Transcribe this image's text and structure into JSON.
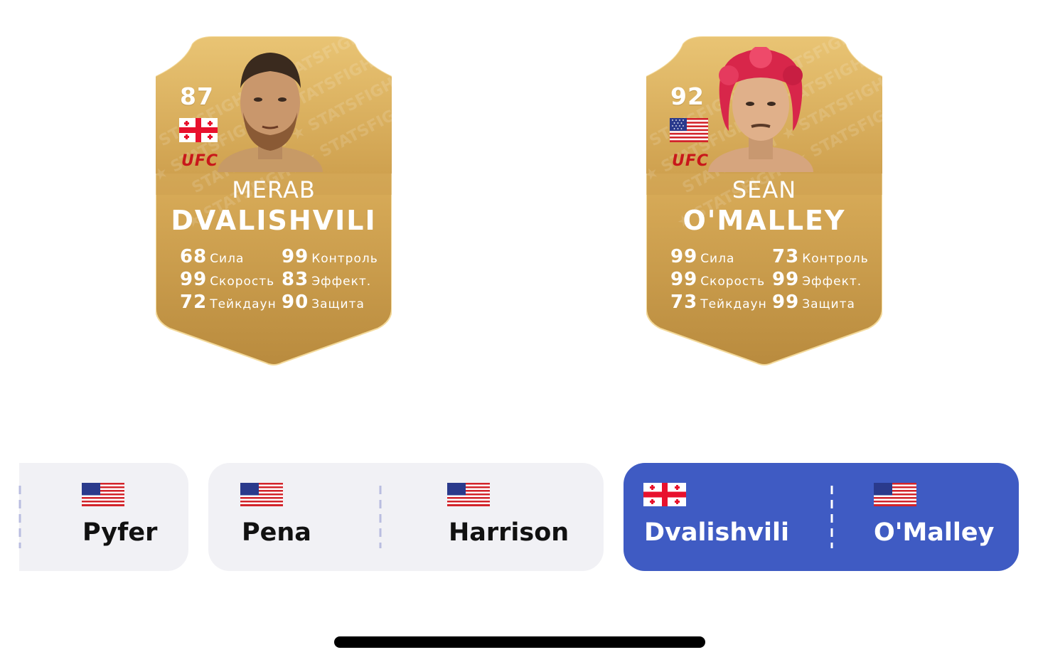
{
  "cards": [
    {
      "rating": "87",
      "first_name": "MERAB",
      "last_name": "DVALISHVILI",
      "league": "UFC",
      "country": "georgia",
      "hair_color": "#3a2a1e",
      "stats": [
        {
          "value": "68",
          "label": "Сила"
        },
        {
          "value": "99",
          "label": "Контроль"
        },
        {
          "value": "99",
          "label": "Скорость"
        },
        {
          "value": "83",
          "label": "Эффект."
        },
        {
          "value": "72",
          "label": "Тейкдаун"
        },
        {
          "value": "90",
          "label": "Защита"
        }
      ]
    },
    {
      "rating": "92",
      "first_name": "SEAN",
      "last_name": "O'MALLEY",
      "league": "UFC",
      "country": "usa",
      "hair_color": "#d8264a",
      "stats": [
        {
          "value": "99",
          "label": "Сила"
        },
        {
          "value": "73",
          "label": "Контроль"
        },
        {
          "value": "99",
          "label": "Скорость"
        },
        {
          "value": "99",
          "label": "Эффект."
        },
        {
          "value": "73",
          "label": "Тейкдаун"
        },
        {
          "value": "99",
          "label": "Защита"
        }
      ]
    }
  ],
  "watermark": "STATSFIGHT",
  "fights": [
    {
      "red": {
        "name": "Pyfer",
        "country": "usa"
      },
      "blue": null,
      "selected": false
    },
    {
      "red": {
        "name": "Pena",
        "country": "usa"
      },
      "blue": {
        "name": "Harrison",
        "country": "usa"
      },
      "selected": false
    },
    {
      "red": {
        "name": "Dvalishvili",
        "country": "georgia"
      },
      "blue": {
        "name": "O'Malley",
        "country": "usa"
      },
      "selected": true
    }
  ],
  "colors": {
    "card_gold_light": "#e2b864",
    "card_gold_dark": "#b98a3a",
    "chip_bg": "#f1f1f5",
    "selected_bg": "#3f5bc3",
    "ufc_red": "#c8181b"
  }
}
